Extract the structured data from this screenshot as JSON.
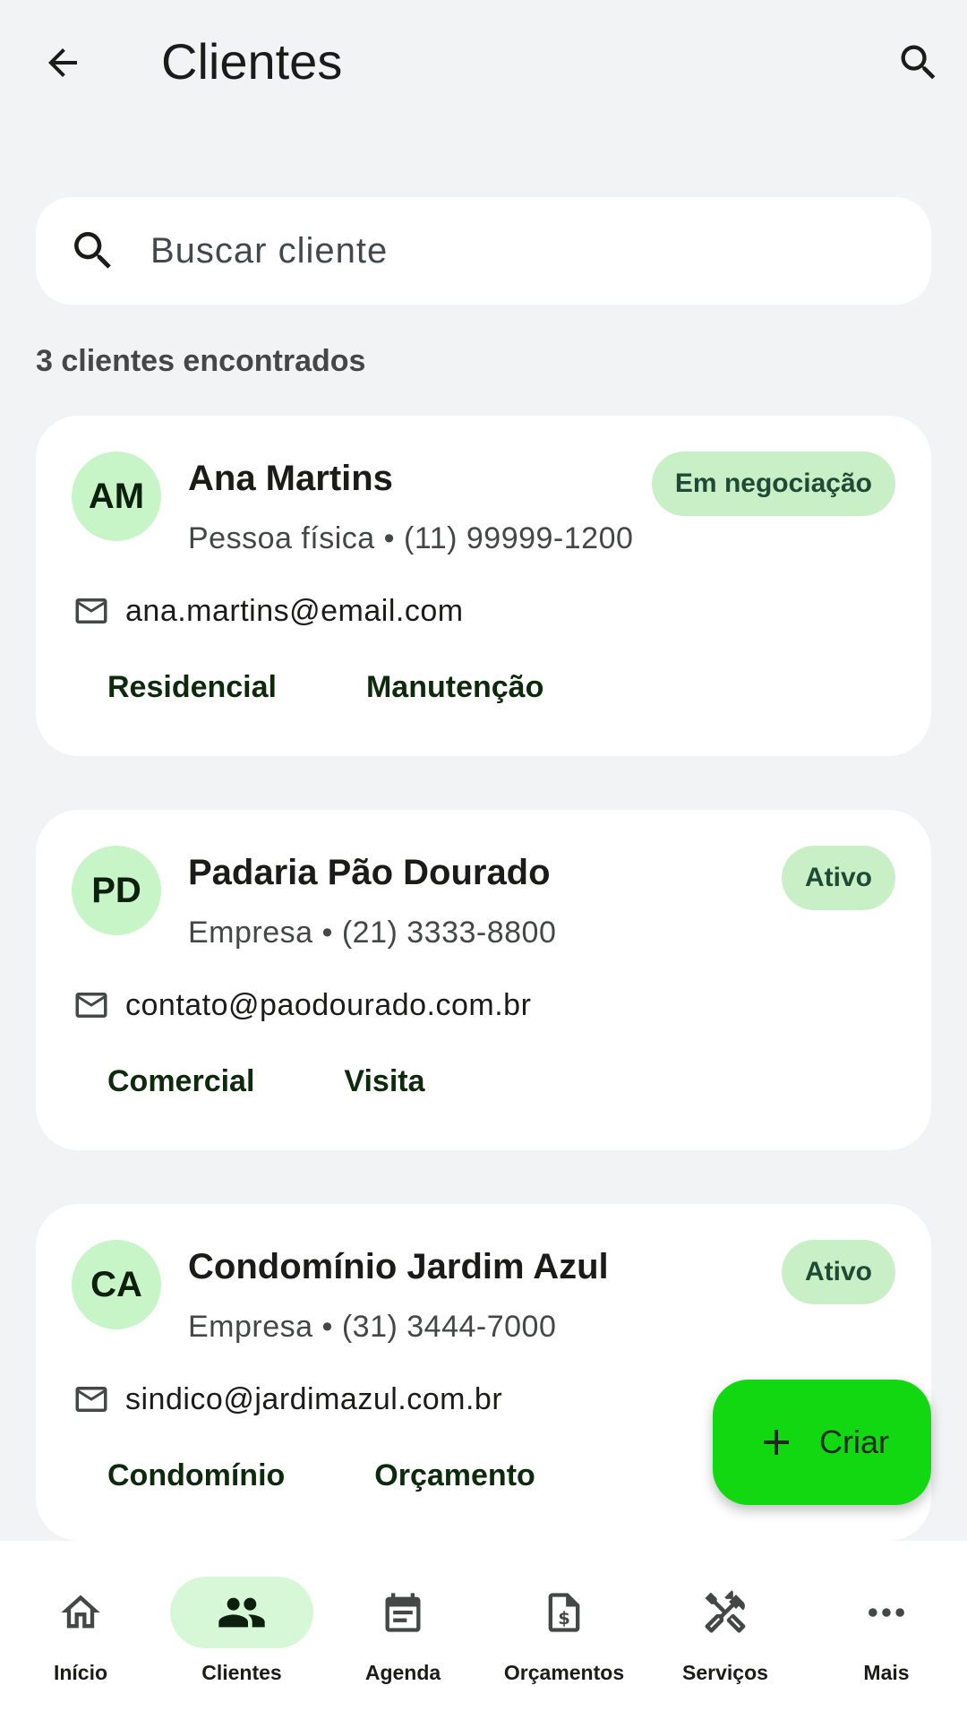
{
  "header": {
    "title": "Clientes"
  },
  "search": {
    "placeholder": "Buscar cliente"
  },
  "result_count": "3 clientes encontrados",
  "clients": [
    {
      "initials": "AM",
      "name": "Ana Martins",
      "subtitle": "Pessoa física • (11) 99999-1200",
      "status": "Em negociação",
      "email": "ana.martins@email.com",
      "tags": [
        "Residencial",
        "Manutenção"
      ]
    },
    {
      "initials": "PD",
      "name": "Padaria Pão Dourado",
      "subtitle": "Empresa • (21) 3333-8800",
      "status": "Ativo",
      "email": "contato@paodourado.com.br",
      "tags": [
        "Comercial",
        "Visita"
      ]
    },
    {
      "initials": "CA",
      "name": "Condomínio Jardim Azul",
      "subtitle": "Empresa • (31) 3444-7000",
      "status": "Ativo",
      "email": "sindico@jardimazul.com.br",
      "tags": [
        "Condomínio",
        "Orçamento"
      ]
    }
  ],
  "fab": {
    "label": "Criar"
  },
  "nav": [
    {
      "label": "Início",
      "icon": "home-icon"
    },
    {
      "label": "Clientes",
      "icon": "people-icon",
      "active": true
    },
    {
      "label": "Agenda",
      "icon": "calendar-icon"
    },
    {
      "label": "Orçamentos",
      "icon": "invoice-icon"
    },
    {
      "label": "Serviços",
      "icon": "tools-icon"
    },
    {
      "label": "Mais",
      "icon": "more-icon"
    }
  ],
  "colors": {
    "background": "#f2f3f5",
    "avatar": "#c8f5c8",
    "badge": "#c8efc6",
    "fab": "#12d812",
    "nav_active": "#d6f8d6"
  }
}
